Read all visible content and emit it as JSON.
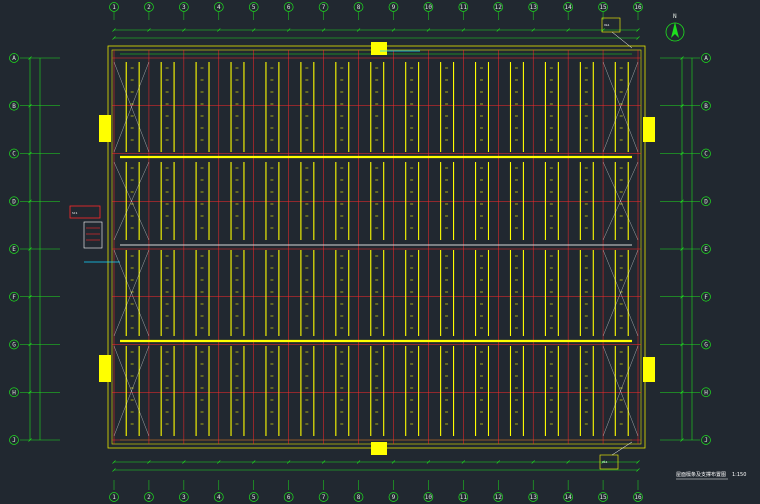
{
  "drawing": {
    "title": "屋面檩条及支撑布置图",
    "scale": "1:150",
    "north_label": "N"
  },
  "grid": {
    "columns": [
      "1",
      "2",
      "3",
      "4",
      "5",
      "6",
      "7",
      "8",
      "9",
      "10",
      "11",
      "12",
      "13",
      "14",
      "15",
      "16"
    ],
    "rows": [
      "A",
      "B",
      "C",
      "D",
      "E",
      "F",
      "G",
      "H",
      "J"
    ]
  },
  "colors": {
    "background": "#212830",
    "purlin": "#ffff00",
    "axis": "#ff2a2a",
    "dimension": "#1ee01e",
    "frame": "#e6e600",
    "cyan": "#16d6ff",
    "white": "#ffffff"
  },
  "notes": {
    "top_right": "XG1",
    "bottom_right": "XG1",
    "left_legend": "SC1"
  }
}
